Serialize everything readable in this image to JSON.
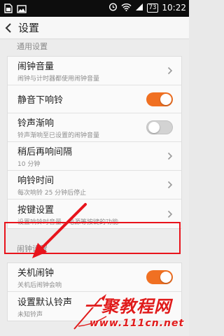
{
  "status_bar": {
    "time": "10:22",
    "battery": "73",
    "icons": [
      "sim-card-icon",
      "image-icon",
      "alarm-icon",
      "wifi-icon",
      "signal-icon",
      "battery-icon"
    ]
  },
  "header": {
    "title": "设置",
    "back_icon": "back-arrow-icon"
  },
  "sections": {
    "general": {
      "title": "通用设置",
      "items": [
        {
          "title": "闹钟音量",
          "subtitle": "闹钟与计时器都使用闹钟音量",
          "control": "chevron"
        },
        {
          "title": "静音下响铃",
          "control": "toggle",
          "on": true
        },
        {
          "title": "铃声渐响",
          "subtitle": "铃声渐响至已设置的闹钟音量",
          "control": "toggle",
          "on": false
        },
        {
          "title": "稍后再响间隔",
          "subtitle": "10 分钟",
          "control": "chevron"
        },
        {
          "title": "响铃时间",
          "subtitle": "每次响铃 25 分钟后停止",
          "control": "chevron"
        },
        {
          "title": "按键设置",
          "subtitle": "设置响铃时音量、电源等按键的功能",
          "control": "chevron"
        }
      ]
    },
    "alarm": {
      "title": "闹钟设置",
      "items": [
        {
          "title": "关机闹钟",
          "subtitle": "关机后闹钟会响",
          "control": "toggle",
          "on": true
        },
        {
          "title": "设置默认铃声",
          "subtitle": "未知铃声",
          "control": "chevron"
        }
      ]
    }
  },
  "watermark": {
    "main": "一聚教程网",
    "url": "www.111cn.net"
  },
  "colors": {
    "accent": "#f07022",
    "highlight": "#e8141c",
    "watermark": "#e01b1b"
  }
}
